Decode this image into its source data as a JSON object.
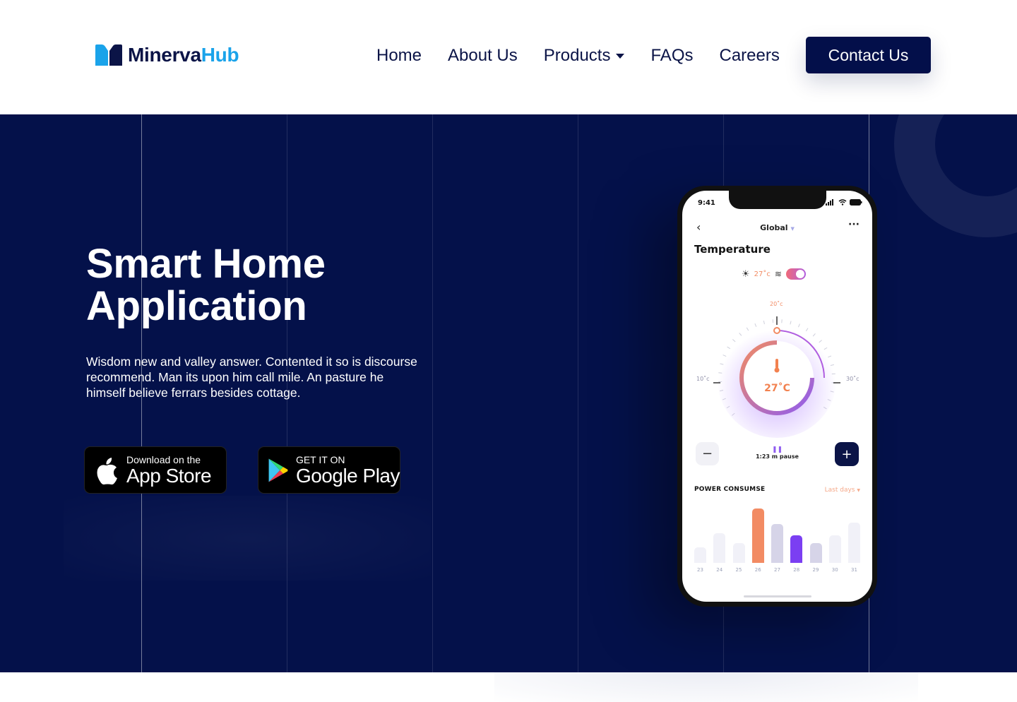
{
  "header": {
    "logo": {
      "part1": "Minerva",
      "part2": "Hub",
      "icon": "logo-mark-icon",
      "accent_color": "#1aa3ea",
      "brand_color": "#0b1447"
    },
    "nav": [
      {
        "label": "Home"
      },
      {
        "label": "About Us"
      },
      {
        "label": "Products",
        "has_dropdown": true
      },
      {
        "label": "FAQs"
      },
      {
        "label": "Careers"
      }
    ],
    "contact_label": "Contact Us"
  },
  "hero": {
    "background": "#04114a",
    "title_line1": "Smart Home",
    "title_line2": "Application",
    "description": "Wisdom new and valley answer. Contented it so is discourse recommend. Man its upon him call mile. An pasture he himself believe ferrars besides cottage.",
    "app_store": {
      "small": "Download on the",
      "big": "App Store",
      "icon": "apple-icon"
    },
    "google_play": {
      "small": "GET IT ON",
      "big": "Google Play",
      "icon": "google-play-icon"
    }
  },
  "phone": {
    "time": "9:41",
    "header_title": "Global",
    "section_title": "Temperature",
    "mode_temp": "27˚c",
    "dial": {
      "top_label": "20˚c",
      "left_label": "10˚c",
      "right_label": "30˚c",
      "center_temp": "27˚C"
    },
    "pause_label": "1:23 m pause",
    "power_title": "POWER CONSUMSE",
    "range_label": "Last days",
    "chart": {
      "days": [
        "23",
        "24",
        "25",
        "26",
        "27",
        "28",
        "29",
        "30",
        "31"
      ],
      "values": [
        0.28,
        0.55,
        0.36,
        1.0,
        0.72,
        0.5,
        0.36,
        0.5,
        0.74
      ],
      "colors": [
        "#f1f1f8",
        "#f1f1f8",
        "#f1f1f8",
        "#f28b63",
        "#d6d4e8",
        "#7b3ff2",
        "#d6d4e8",
        "#f1f1f8",
        "#f1f1f8"
      ]
    }
  }
}
